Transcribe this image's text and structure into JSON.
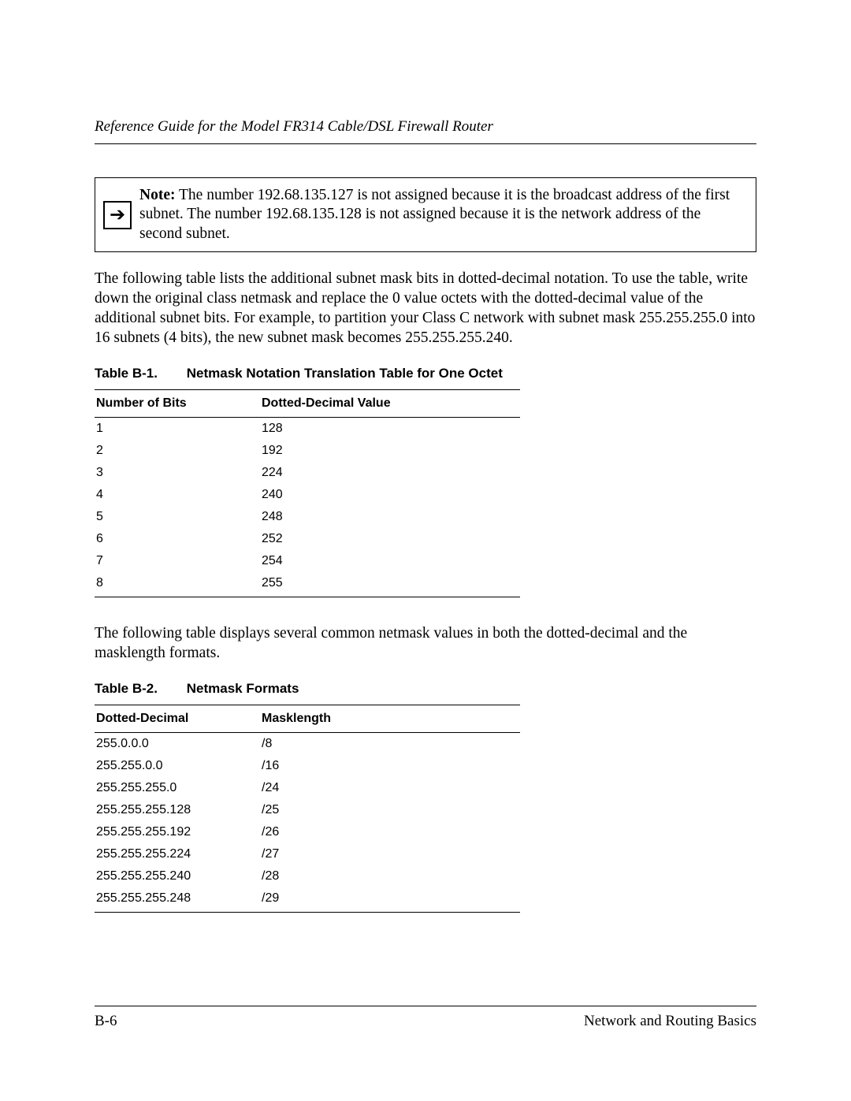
{
  "header": {
    "running_title": "Reference Guide for the Model FR314 Cable/DSL Firewall Router"
  },
  "note": {
    "label": "Note:",
    "text": "The number 192.68.135.127 is not assigned because it is the broadcast address of the first subnet. The number 192.68.135.128 is not assigned because it is the network address of the second subnet."
  },
  "para1": "The following table lists the additional subnet mask bits in dotted-decimal notation. To use the table, write down the original class netmask and replace the 0 value octets with the dotted-decimal value of the additional subnet bits. For example, to partition your Class C network with subnet mask 255.255.255.0 into 16 subnets (4 bits), the new subnet mask becomes 255.255.255.240.",
  "table1": {
    "caption_num": "Table B-1.",
    "caption_title": "Netmask Notation Translation Table for One Octet",
    "col_a": "Number of Bits",
    "col_b": "Dotted-Decimal Value",
    "rows": [
      {
        "a": "1",
        "b": "128"
      },
      {
        "a": "2",
        "b": "192"
      },
      {
        "a": "3",
        "b": "224"
      },
      {
        "a": "4",
        "b": "240"
      },
      {
        "a": "5",
        "b": "248"
      },
      {
        "a": "6",
        "b": "252"
      },
      {
        "a": "7",
        "b": "254"
      },
      {
        "a": "8",
        "b": "255"
      }
    ]
  },
  "para2": "The following table displays several common netmask values in both the dotted-decimal and the masklength formats.",
  "table2": {
    "caption_num": "Table B-2.",
    "caption_title": "Netmask Formats",
    "col_a": "Dotted-Decimal",
    "col_b": "Masklength",
    "rows": [
      {
        "a": "255.0.0.0",
        "b": "/8"
      },
      {
        "a": "255.255.0.0",
        "b": "/16"
      },
      {
        "a": "255.255.255.0",
        "b": "/24"
      },
      {
        "a": "255.255.255.128",
        "b": "/25"
      },
      {
        "a": "255.255.255.192",
        "b": "/26"
      },
      {
        "a": "255.255.255.224",
        "b": "/27"
      },
      {
        "a": "255.255.255.240",
        "b": "/28"
      },
      {
        "a": "255.255.255.248",
        "b": "/29"
      }
    ]
  },
  "footer": {
    "page_num": "B-6",
    "section": "Network and Routing Basics"
  },
  "icons": {
    "note_arrow": "➔"
  }
}
